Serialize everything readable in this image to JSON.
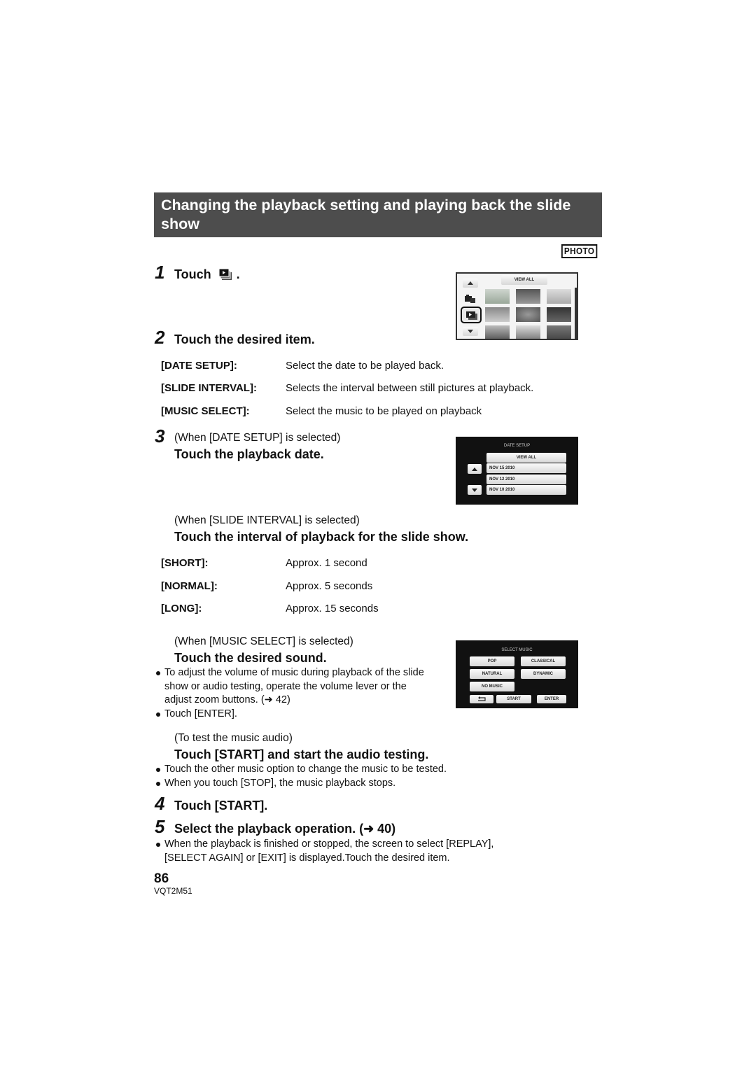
{
  "header": {
    "title": "Changing the playback setting and playing back the slide show",
    "mode_badge": "PHOTO"
  },
  "steps": {
    "s1": {
      "num": "1",
      "text": "Touch",
      "icon": "slideshow-icon",
      "suffix": "."
    },
    "s2": {
      "num": "2",
      "text": "Touch the desired item.",
      "items": [
        {
          "term": "[DATE SETUP]:",
          "desc": "Select the date to be played back."
        },
        {
          "term": "[SLIDE INTERVAL]:",
          "desc": "Selects the interval between still pictures at playback."
        },
        {
          "term": "[MUSIC SELECT]:",
          "desc": "Select the music to be played on playback"
        }
      ]
    },
    "s3": {
      "num": "3",
      "date_case": {
        "condition": "(When [DATE SETUP] is selected)",
        "text": "Touch the playback date."
      },
      "interval_case": {
        "condition": "(When [SLIDE INTERVAL] is selected)",
        "text": "Touch the interval of playback for the slide show.",
        "items": [
          {
            "term": "[SHORT]:",
            "desc": "Approx. 1 second"
          },
          {
            "term": "[NORMAL]:",
            "desc": "Approx. 5 seconds"
          },
          {
            "term": "[LONG]:",
            "desc": "Approx. 15 seconds"
          }
        ]
      },
      "music_case": {
        "condition": "(When [MUSIC SELECT] is selected)",
        "text": "Touch the desired sound.",
        "bullets": [
          "To adjust the volume of music during playback of the slide show or audio testing, operate the volume lever or the adjust zoom buttons. (➜ 42)",
          "Touch [ENTER]."
        ]
      },
      "test_case": {
        "condition": "(To test the music audio)",
        "text": "Touch [START] and start the audio testing.",
        "bullets": [
          "Touch the other music option to change the music to be tested.",
          "When you touch [STOP], the music playback stops."
        ]
      }
    },
    "s4": {
      "num": "4",
      "text": "Touch [START]."
    },
    "s5": {
      "num": "5",
      "text": "Select the playback operation. (➜ 40)",
      "bullets": [
        "When the playback is finished or stopped, the screen to select [REPLAY], [SELECT AGAIN] or [EXIT] is displayed.Touch the desired item."
      ]
    }
  },
  "screens": {
    "thumbs": {
      "view_all": "VIEW ALL"
    },
    "date_setup": {
      "title": "DATE SETUP",
      "options": [
        "VIEW ALL",
        "NOV 15 2010",
        "NOV 12 2010",
        "NOV 10 2010"
      ]
    },
    "select_music": {
      "title": "SELECT MUSIC",
      "options": [
        "POP",
        "CLASSICAL",
        "NATURAL",
        "DYNAMIC",
        "NO MUSIC"
      ],
      "start": "START",
      "enter": "ENTER"
    }
  },
  "footer": {
    "page": "86",
    "code": "VQT2M51"
  }
}
